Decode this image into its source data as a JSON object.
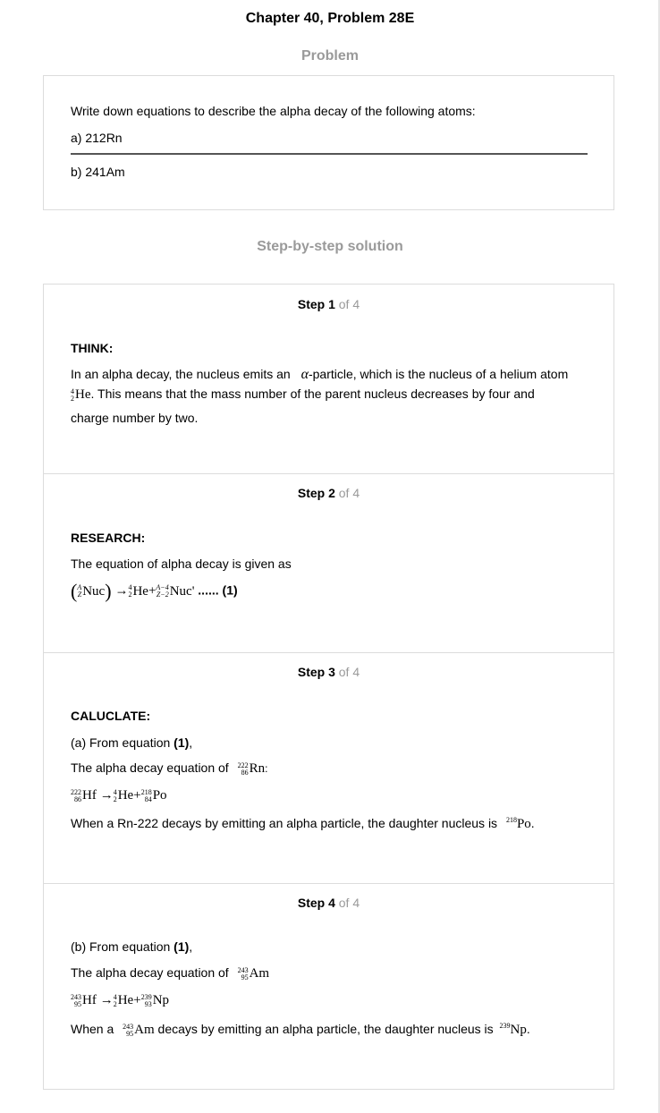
{
  "header": {
    "title": "Chapter 40, Problem 28E"
  },
  "problem": {
    "heading": "Problem",
    "text": "Write down equations to describe the alpha decay of the following atoms:",
    "part_a": "a) 212Rn",
    "part_b": "b) 241Am"
  },
  "solution": {
    "heading": "Step-by-step solution",
    "steps": [
      {
        "label": "Step 1",
        "of": "of 4",
        "heading": "THINK:",
        "line1a": "In an alpha decay, the nucleus emits an",
        "alpha": "α",
        "line1b": "-particle, which is the nucleus of a helium atom",
        "he_mass": "4",
        "he_charge": "2",
        "he_sym": "He",
        "line2": ". This means that the mass number of the parent nucleus decreases by four and",
        "line3": "charge number by two."
      },
      {
        "label": "Step 2",
        "of": "of 4",
        "heading": "RESEARCH:",
        "intro": "The equation of alpha decay is given as",
        "eq": {
          "nuc_mass": "A",
          "nuc_charge": "Z",
          "nuc_sym": "Nuc",
          "arrow": "→",
          "he_mass": "4",
          "he_charge": "2",
          "he_sym": "He",
          "plus": "+",
          "d_mass": "A−4",
          "d_charge": "Z−2",
          "d_sym": "Nuc'",
          "dots": "......",
          "num": "(1)"
        }
      },
      {
        "label": "Step 3",
        "of": "of 4",
        "heading": "CALUCLATE:",
        "from_a": "(a) From equation ",
        "from_ref": "(1)",
        "from_end": ",",
        "eq_intro": "The alpha decay equation of",
        "rn_mass": "222",
        "rn_charge": "86",
        "rn_sym": "Rn",
        "colon": ":",
        "eq": {
          "p_mass": "222",
          "p_charge": "86",
          "p_sym": "Hf",
          "arrow": "→",
          "he_mass": "4",
          "he_charge": "2",
          "he_sym": "He",
          "plus": "+",
          "d_mass": "218",
          "d_charge": "84",
          "d_sym": "Po"
        },
        "result_a": "When a Rn-222 decays by emitting an alpha particle, the daughter nucleus is",
        "res_mass": "218",
        "res_sym": "Po",
        "res_end": "."
      },
      {
        "label": "Step 4",
        "of": "of 4",
        "from_b": "(b) From equation ",
        "from_ref": "(1)",
        "from_end": ",",
        "eq_intro": "The alpha decay equation of",
        "am_mass": "243",
        "am_charge": "95",
        "am_sym": "Am",
        "eq": {
          "p_mass": "243",
          "p_charge": "95",
          "p_sym": "Hf",
          "arrow": "→",
          "he_mass": "4",
          "he_charge": "2",
          "he_sym": "He",
          "plus": "+",
          "d_mass": "239",
          "d_charge": "93",
          "d_sym": "Np"
        },
        "result_a": "When a",
        "am2_mass": "243",
        "am2_charge": "95",
        "am2_sym": "Am",
        "result_b": "decays by emitting an alpha particle, the daughter nucleus is",
        "res_mass": "239",
        "res_sym": "Np",
        "res_end": "."
      }
    ]
  }
}
